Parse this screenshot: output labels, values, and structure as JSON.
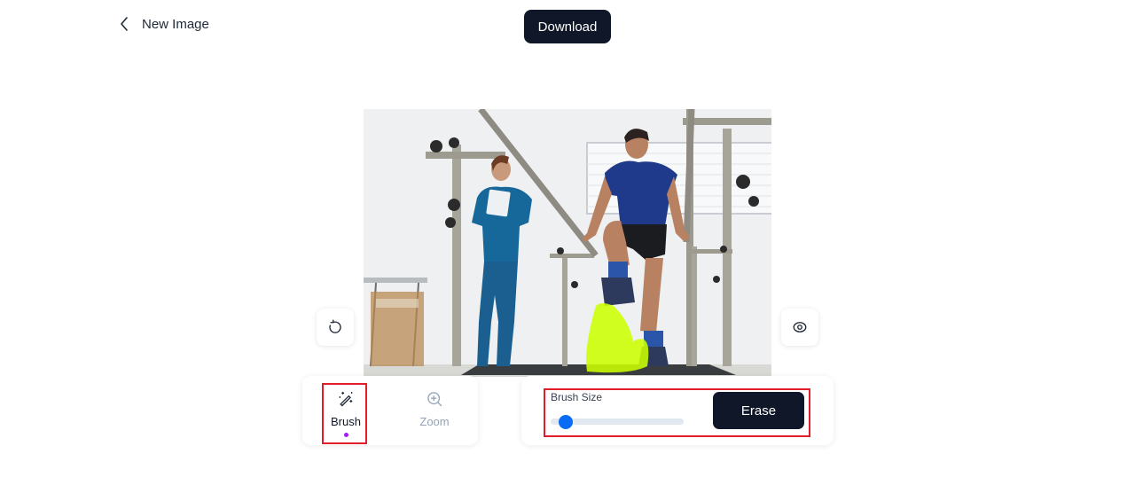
{
  "header": {
    "back_icon": "chevron-left-icon",
    "back_label": "New Image",
    "download_label": "Download"
  },
  "canvas": {
    "image_description": "Physical therapy session: nurse in blue scrubs holding tablet beside man in navy shirt stepping over cones between parallel bars",
    "mask_color": "#ccff00"
  },
  "side_controls": {
    "undo_icon": "rotate-ccw-icon",
    "preview_icon": "eye-icon"
  },
  "tools": {
    "items": [
      {
        "label": "Brush",
        "icon": "magic-wand-icon",
        "active": true
      },
      {
        "label": "Zoom",
        "icon": "zoom-in-icon",
        "active": false
      }
    ],
    "active_dot_color": "#a21cf5"
  },
  "brush_settings": {
    "label": "Brush Size",
    "value_fraction": 0.11,
    "erase_label": "Erase"
  },
  "colors": {
    "primary_dark": "#0f1728",
    "slider_accent": "#0a6cf5",
    "highlight_box": "#e11d2a"
  }
}
